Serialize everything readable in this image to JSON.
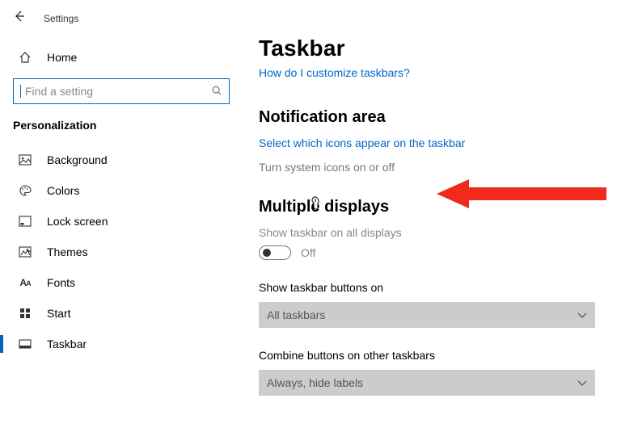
{
  "header": {
    "title": "Settings"
  },
  "sidebar": {
    "home_label": "Home",
    "search_placeholder": "Find a setting",
    "category_label": "Personalization",
    "items": [
      {
        "label": "Background"
      },
      {
        "label": "Colors"
      },
      {
        "label": "Lock screen"
      },
      {
        "label": "Themes"
      },
      {
        "label": "Fonts"
      },
      {
        "label": "Start"
      },
      {
        "label": "Taskbar"
      }
    ]
  },
  "main": {
    "page_title": "Taskbar",
    "help_link": "How do I customize taskbars?",
    "notification_area": {
      "title": "Notification area",
      "link_icons": "Select which icons appear on the taskbar",
      "link_system_icons": "Turn system icons on or off"
    },
    "multiple_displays": {
      "title": "Multiple displays",
      "show_taskbar_label": "Show taskbar on all displays",
      "toggle_state": "Off",
      "show_buttons_label": "Show taskbar buttons on",
      "show_buttons_value": "All taskbars",
      "combine_label": "Combine buttons on other taskbars",
      "combine_value": "Always, hide labels"
    }
  }
}
